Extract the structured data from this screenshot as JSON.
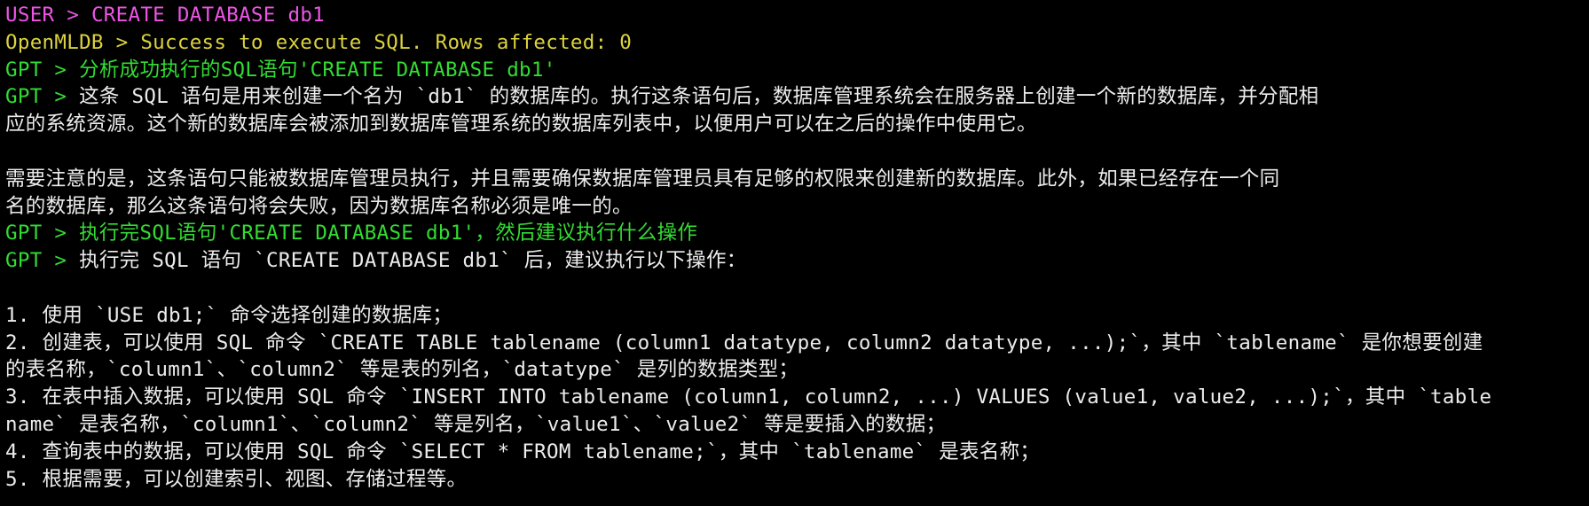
{
  "colors": {
    "background": "#000000",
    "user": "#ee55e6",
    "openmldb": "#dcd33f",
    "gpt": "#33dc33",
    "text": "#ececec"
  },
  "lines": [
    {
      "prompt": "USER > ",
      "text": "CREATE DATABASE db1",
      "style": "user"
    },
    {
      "prompt": "OpenMLDB > ",
      "text": "Success to execute SQL. Rows affected: 0",
      "style": "db"
    },
    {
      "prompt": "GPT > ",
      "text": "分析成功执行的SQL语句'CREATE DATABASE db1'",
      "style": "gpt-q"
    },
    {
      "prompt": "GPT > ",
      "text": "这条 SQL 语句是用来创建一个名为 `db1` 的数据库的。执行这条语句后，数据库管理系统会在服务器上创建一个新的数据库，并分配相",
      "style": "gpt-answer"
    },
    {
      "prompt": "",
      "text": "应的系统资源。这个新的数据库会被添加到数据库管理系统的数据库列表中，以便用户可以在之后的操作中使用它。",
      "style": "text"
    },
    {
      "prompt": "",
      "text": "",
      "style": "blank"
    },
    {
      "prompt": "",
      "text": "需要注意的是，这条语句只能被数据库管理员执行，并且需要确保数据库管理员具有足够的权限来创建新的数据库。此外，如果已经存在一个同",
      "style": "text"
    },
    {
      "prompt": "",
      "text": "名的数据库，那么这条语句将会失败，因为数据库名称必须是唯一的。",
      "style": "text"
    },
    {
      "prompt": "GPT > ",
      "text": "执行完SQL语句'CREATE DATABASE db1'，然后建议执行什么操作",
      "style": "gpt-q"
    },
    {
      "prompt": "GPT > ",
      "text": "执行完 SQL 语句 `CREATE DATABASE db1` 后，建议执行以下操作：",
      "style": "gpt-answer"
    },
    {
      "prompt": "",
      "text": "",
      "style": "blank"
    },
    {
      "prompt": "",
      "text": "1. 使用 `USE db1;` 命令选择创建的数据库；",
      "style": "text"
    },
    {
      "prompt": "",
      "text": "2. 创建表，可以使用 SQL 命令 `CREATE TABLE tablename (column1 datatype, column2 datatype, ...);`，其中 `tablename` 是你想要创建",
      "style": "text"
    },
    {
      "prompt": "",
      "text": "的表名称，`column1`、`column2` 等是表的列名，`datatype` 是列的数据类型；",
      "style": "text"
    },
    {
      "prompt": "",
      "text": "3. 在表中插入数据，可以使用 SQL 命令 `INSERT INTO tablename (column1, column2, ...) VALUES (value1, value2, ...);`，其中 `table",
      "style": "text"
    },
    {
      "prompt": "",
      "text": "name` 是表名称，`column1`、`column2` 等是列名，`value1`、`value2` 等是要插入的数据；",
      "style": "text"
    },
    {
      "prompt": "",
      "text": "4. 查询表中的数据，可以使用 SQL 命令 `SELECT * FROM tablename;`，其中 `tablename` 是表名称；",
      "style": "text"
    },
    {
      "prompt": "",
      "text": "5. 根据需要，可以创建索引、视图、存储过程等。",
      "style": "text"
    }
  ]
}
